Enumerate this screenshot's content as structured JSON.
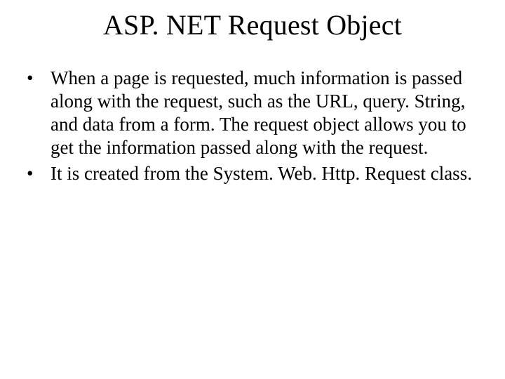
{
  "slide": {
    "title": "ASP. NET Request Object",
    "bullets": [
      "When a page is requested, much information is passed along with the request, such as the URL, query. String, and data from a form. The request object allows you to get the information passed along with the request.",
      "It is created from the System. Web. Http. Request class."
    ]
  }
}
